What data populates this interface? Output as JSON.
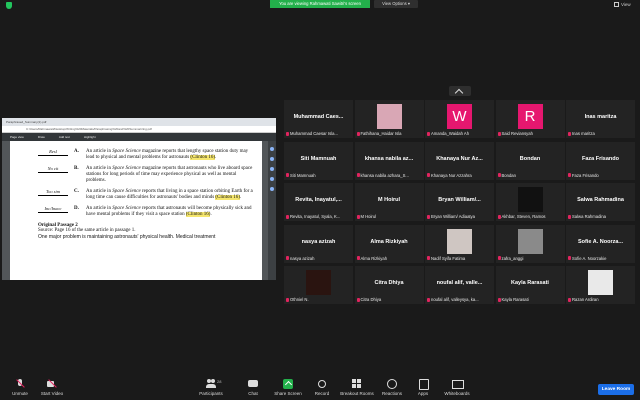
{
  "top": {
    "banner": "You are viewing Rahmawati Sawitri's screen",
    "view_options": "View Options ▾",
    "view": "View"
  },
  "browser": {
    "tab": "Paraphrased_Summary(1).pdf",
    "address": "C:/Users/Rahmawati/Desktop/Writing%20Materials/Paraphrasing%20and%20Summarizing.pdf",
    "toolbar": [
      "Page view",
      "Draw",
      "Add text",
      "Highlight"
    ]
  },
  "pdf": {
    "items": [
      {
        "answer": "Resl",
        "letter": "A.",
        "pre": "An article in ",
        "italic": "Space Science",
        "post": " magazine reports that lengthy space station duty may lead to physical and mental problems for astronauts ",
        "cite": "(Clinton 16)",
        "end": "."
      },
      {
        "answer": "No cit",
        "letter": "B.",
        "pre": "An article in ",
        "italic": "Space Science",
        "post": " magazine reports that astronauts who live aboard space stations for long periods of time may experience physical as well as mental problems.",
        "cite": "",
        "end": ""
      },
      {
        "answer": "Too sim",
        "letter": "C.",
        "pre": "An article in ",
        "italic": "Space Science",
        "post": " reports that living in a space station orbiting Earth for a long time can cause difficulties for astronauts' bodies and minds ",
        "cite": "(Clinton 16)",
        "end": "."
      },
      {
        "answer": "Inc/Inacc",
        "letter": "D.",
        "pre": "An article in ",
        "italic": "Space Science",
        "post": " reports that astronauts will become physically sick and have mental problems if they visit a space station ",
        "cite": "(Clinton 16)",
        "end": "."
      }
    ],
    "orig_title": "Original Passage 2",
    "orig_source": "Source: Page 16 of the same article in passage 1.",
    "orig_text": "One major problem is maintaining astronauts' physical health. Medical treatment"
  },
  "participants": [
    {
      "big": "Muhammad Caes...",
      "small": "Muhammad Caesar Isla...",
      "type": "name"
    },
    {
      "big": "",
      "small": "Fathihana_Haidar Isla",
      "type": "photo",
      "color": "#d9a7b5"
    },
    {
      "big": "",
      "small": "Amanda_Waidah Ah",
      "type": "letter",
      "letter": "W"
    },
    {
      "big": "",
      "small": "Said Reviansyah",
      "type": "letter",
      "letter": "R"
    },
    {
      "big": "Inas maritza",
      "small": "Inas maritza",
      "type": "name"
    },
    {
      "big": "Siti Mamnuah",
      "small": "Siti Mamnuah",
      "type": "name"
    },
    {
      "big": "khansa nabila az...",
      "small": "khansa nabila azhara_S...",
      "type": "name"
    },
    {
      "big": "Khanaya Nur Az...",
      "small": "Khanaya Nur Azzahra",
      "type": "name"
    },
    {
      "big": "Bondan",
      "small": "Bondan",
      "type": "name"
    },
    {
      "big": "Faza Frisando",
      "small": "Faza Frisando",
      "type": "name"
    },
    {
      "big": "Revita, Inayatul,...",
      "small": "Revita, Inayatul, Syala, K...",
      "type": "name"
    },
    {
      "big": "M Hoirul",
      "small": "M Hoirul",
      "type": "name"
    },
    {
      "big": "Bryan William/...",
      "small": "Bryan William/ Adiaatya",
      "type": "name"
    },
    {
      "big": "",
      "small": "Akhbar, Steven, Ramos",
      "type": "photo",
      "color": "#111111"
    },
    {
      "big": "Salwa Rahmadina",
      "small": "Salwa Rahmadina",
      "type": "name"
    },
    {
      "big": "nasya azizah",
      "small": "nasya azizah",
      "type": "name"
    },
    {
      "big": "Alma Rizkiyah",
      "small": "Alma Rizkiyah",
      "type": "name"
    },
    {
      "big": "",
      "small": "Nadif Syifa Fatima",
      "type": "photo",
      "color": "#cfc6c2"
    },
    {
      "big": "",
      "small": "zafra_anggi",
      "type": "photo",
      "color": "#8a8a8a"
    },
    {
      "big": "Sofie A. Noorza...",
      "small": "Sofie A. Noorzakie",
      "type": "name"
    },
    {
      "big": "",
      "small": "Othniel N.",
      "type": "photo",
      "color": "#2a1410"
    },
    {
      "big": "Citra Dhiya",
      "small": "Citra Dhiya",
      "type": "name"
    },
    {
      "big": "noufal alif, valle...",
      "small": "noufal alif, valleysya, ka...",
      "type": "name"
    },
    {
      "big": "Kayla Rarasati",
      "small": "Kayla Rarasati",
      "type": "name"
    },
    {
      "big": "",
      "small": "Razan Ardiran",
      "type": "photo",
      "color": "#e9e9e9"
    }
  ],
  "toolbar": {
    "unmute": "Unmute",
    "start_video": "Start Video",
    "participants": "Participants",
    "participants_count": "28",
    "chat": "Chat",
    "share_screen": "Share Screen",
    "record": "Record",
    "breakout": "Breakout Rooms",
    "reactions": "Reactions",
    "apps": "Apps",
    "whiteboards": "Whiteboards",
    "leave": "Leave Room"
  },
  "colors": {
    "banner_green": "#23b04b",
    "avatar_pink": "#e6176f",
    "leave_blue": "#1b6ee8",
    "muted_red": "#e0245e"
  }
}
